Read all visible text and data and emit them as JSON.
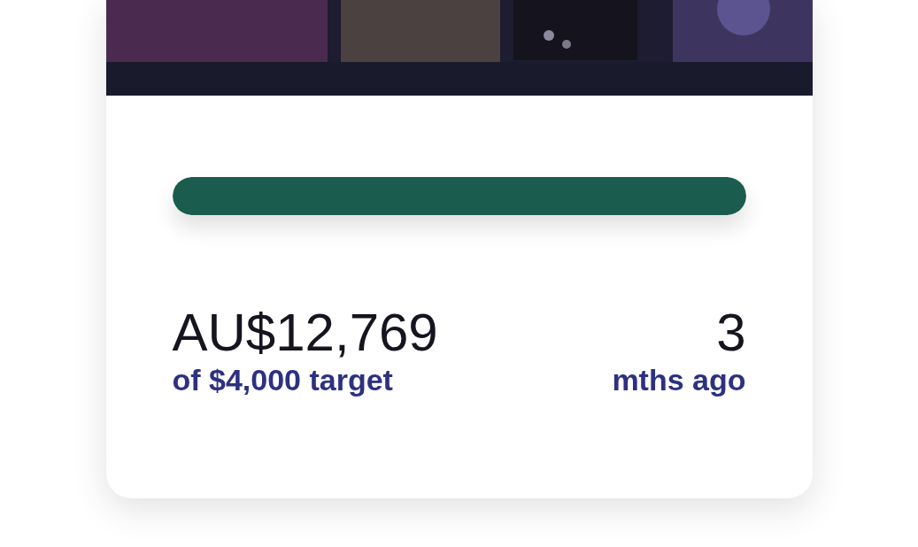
{
  "campaign": {
    "progress": {
      "level": 1
    },
    "raised": "AU$12,769",
    "target": "of $4,000 target",
    "age_value": "3",
    "age_unit": "mths ago"
  }
}
